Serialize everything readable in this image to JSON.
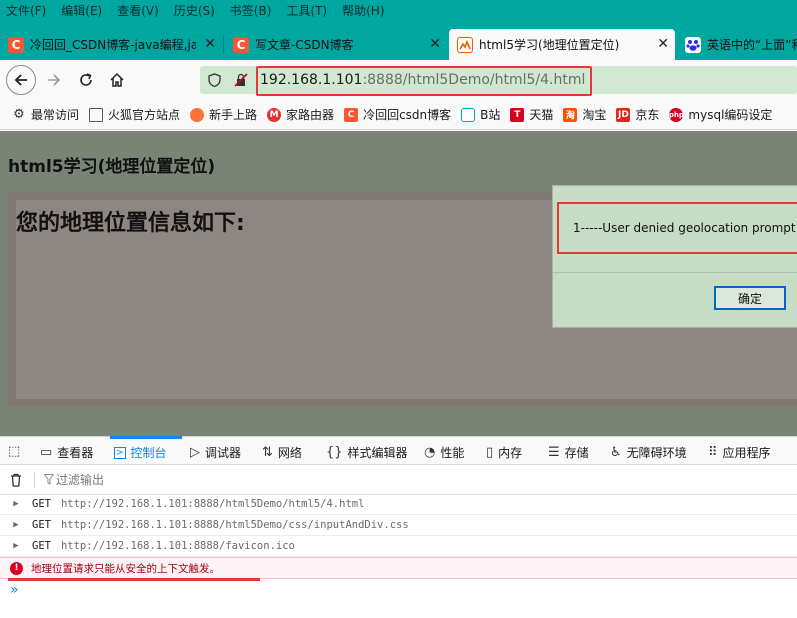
{
  "menubar": [
    "文件(F)",
    "编辑(E)",
    "查看(V)",
    "历史(S)",
    "书签(B)",
    "工具(T)",
    "帮助(H)"
  ],
  "tabs": [
    {
      "title": "冷回回_CSDN博客-java编程,ja",
      "icon": "C",
      "color": "#fc5531"
    },
    {
      "title": "写文章-CSDN博客",
      "icon": "C",
      "color": "#fc5531"
    },
    {
      "title": "html5学习(地理位置定位)",
      "icon": "page",
      "color": "#e66000"
    },
    {
      "title": "英语中的“上面”和",
      "icon": "baidu",
      "color": "#2932e1"
    }
  ],
  "url": {
    "host": "192.168.1.101",
    "rest": ":8888/html5Demo/html5/4.html"
  },
  "bookmarks": [
    "最常访问",
    "火狐官方站点",
    "新手上路",
    "家路由器",
    "冷回回csdn博客",
    "B站",
    "天猫",
    "淘宝",
    "京东",
    "mysql编码设定"
  ],
  "page": {
    "title": "html5学习(地理位置定位)",
    "geo_heading": "您的地理位置信息如下:"
  },
  "dialog": {
    "message": "1-----User denied geolocation prompt",
    "ok_label": "确定"
  },
  "devtools": {
    "tabs": [
      "查看器",
      "控制台",
      "调试器",
      "网络",
      "样式编辑器",
      "性能",
      "内存",
      "存储",
      "无障碍环境",
      "应用程序"
    ],
    "active_tab": "控制台",
    "filter_placeholder": "过滤输出",
    "logs": [
      {
        "method": "GET",
        "url": "http://192.168.1.101:8888/html5Demo/html5/4.html"
      },
      {
        "method": "GET",
        "url": "http://192.168.1.101:8888/html5Demo/css/inputAndDiv.css"
      },
      {
        "method": "GET",
        "url": "http://192.168.1.101:8888/favicon.ico"
      }
    ],
    "error": "地理位置请求只能从安全的上下文触发。",
    "prompt": "»"
  }
}
